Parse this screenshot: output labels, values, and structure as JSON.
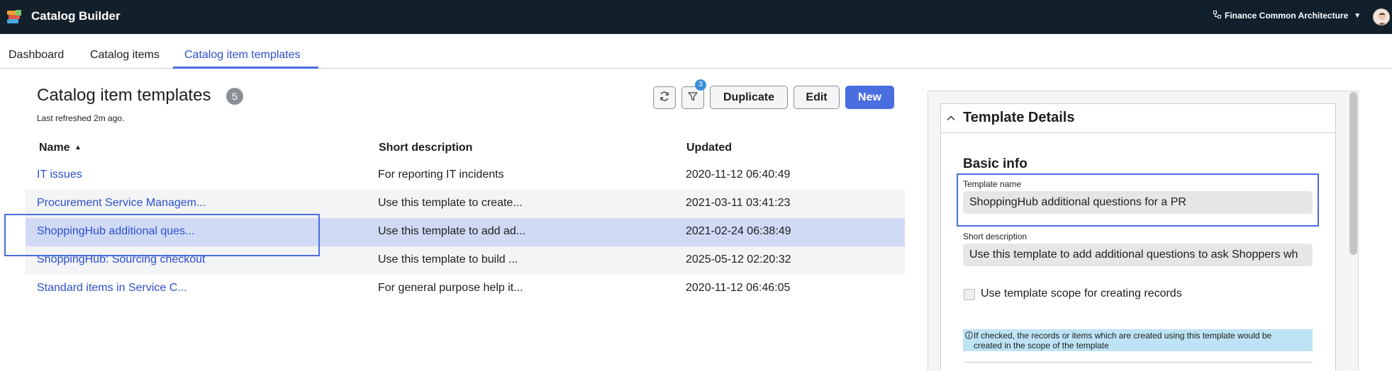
{
  "app": {
    "title": "Catalog Builder",
    "scope_label": "Finance Common Architecture"
  },
  "tabs": [
    {
      "label": "Dashboard"
    },
    {
      "label": "Catalog items"
    },
    {
      "label": "Catalog item templates",
      "active": true
    }
  ],
  "list": {
    "title": "Catalog item templates",
    "count": "5",
    "last_refreshed": "Last refreshed 2m ago.",
    "filter_count": "3",
    "actions": {
      "duplicate": "Duplicate",
      "edit": "Edit",
      "new": "New"
    },
    "columns": [
      {
        "label": "Name",
        "sorted": "asc"
      },
      {
        "label": "Short description"
      },
      {
        "label": "Updated"
      }
    ],
    "rows": [
      {
        "name": "IT issues",
        "description": "For reporting IT incidents",
        "updated": "2020-11-12 06:40:49"
      },
      {
        "name": "Procurement Service Managem...",
        "description": "Use this template to create...",
        "updated": "2021-03-11 03:41:23"
      },
      {
        "name": "ShoppingHub additional ques...",
        "description": "Use this template to add ad...",
        "updated": "2021-02-24 06:38:49",
        "selected": true
      },
      {
        "name": "ShoppingHub: Sourcing checkout",
        "description": "Use this template to build ...",
        "updated": "2025-05-12 02:20:32"
      },
      {
        "name": "Standard items in Service C...",
        "description": "For general purpose help it...",
        "updated": "2020-11-12 06:46:05"
      }
    ]
  },
  "details": {
    "title": "Template Details",
    "section": "Basic info",
    "template_name_label": "Template name",
    "template_name_value": "ShoppingHub additional questions for a PR",
    "short_description_label": "Short description",
    "short_description_value": "Use this template to add additional questions to ask Shoppers wh",
    "scope_checkbox_label": "Use template scope for creating records",
    "scope_checkbox_checked": false,
    "info_text_line1": "If checked, the records or items which are created using this template would be",
    "info_text_line2": "created in the scope of the template"
  },
  "colors": {
    "topbar": "#12202b",
    "accent": "#4a6ee0",
    "link": "#2b4fcf",
    "selected_row": "#d0daf5",
    "info_bg": "#bde3f5"
  },
  "icons": {
    "logo": "catalog-builder-logo",
    "scope": "application-scope-icon",
    "refresh": "refresh-icon",
    "filter": "filter-icon",
    "sort": "sort-ascending-icon",
    "collapse": "chevron-up-icon",
    "info": "info-icon"
  }
}
